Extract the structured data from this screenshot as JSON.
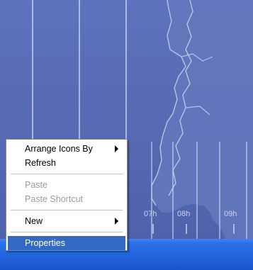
{
  "map": {
    "hour_labels": [
      "07h",
      "08h",
      "09h"
    ]
  },
  "context_menu": {
    "items": [
      {
        "label": "Arrange Icons By",
        "enabled": true,
        "submenu": true
      },
      {
        "label": "Refresh",
        "enabled": true,
        "submenu": false
      },
      {
        "label": "Paste",
        "enabled": false,
        "submenu": false
      },
      {
        "label": "Paste Shortcut",
        "enabled": false,
        "submenu": false
      },
      {
        "label": "New",
        "enabled": true,
        "submenu": true
      },
      {
        "label": "Properties",
        "enabled": true,
        "submenu": false,
        "selected": true
      }
    ]
  },
  "colors": {
    "desktop": "#5a6fb6",
    "taskbar": "#1f5fd8",
    "selection": "#316ac5"
  }
}
